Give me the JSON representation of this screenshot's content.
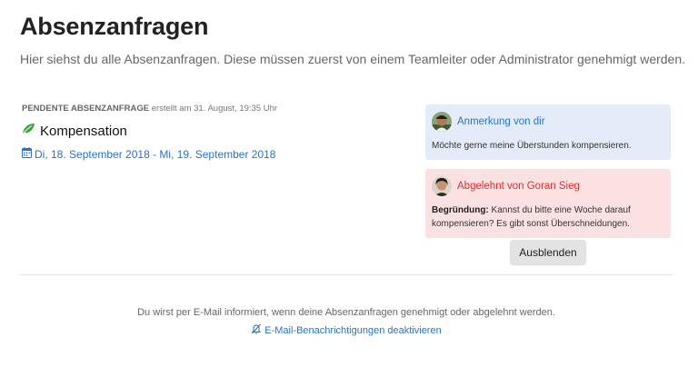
{
  "header": {
    "title": "Absenzanfragen",
    "subtitle": "Hier siehst du alle Absenzanfragen. Diese müssen zuerst von einem Teamleiter oder Administrator genehmigt werden."
  },
  "request": {
    "status": "PENDENTE ABSENZANFRAGE",
    "created": "erstellt am 31. August, 19:35 Uhr",
    "type_icon": "leaf-icon",
    "type": "Kompensation",
    "date_icon": "calendar-icon",
    "date_range": "Di, 18. September 2018 - Mi, 19. September 2018"
  },
  "note": {
    "title": "Anmerkung von dir",
    "text": "Möchte gerne meine Überstunden kompensieren."
  },
  "rejection": {
    "title": "Abgelehnt von Goran Sieg",
    "reason_label": "Begründung:",
    "reason_text": "Kannst du bitte eine Woche darauf kompensieren? Es gibt sonst Überschneidungen."
  },
  "hide_button": "Ausblenden",
  "footer": {
    "text": "Du wirst per E-Mail informiert, wenn deine Absenzanfragen genehmigt oder abgelehnt werden.",
    "link": "E-Mail-Benachrichtigungen deaktivieren",
    "link_icon": "bell-slash-icon"
  },
  "colors": {
    "link": "#2a73c4",
    "note_bg": "#e3ecf8",
    "reject_bg": "#fbe1e1",
    "reject_text": "#d9302e",
    "leaf": "#3fa63a"
  }
}
